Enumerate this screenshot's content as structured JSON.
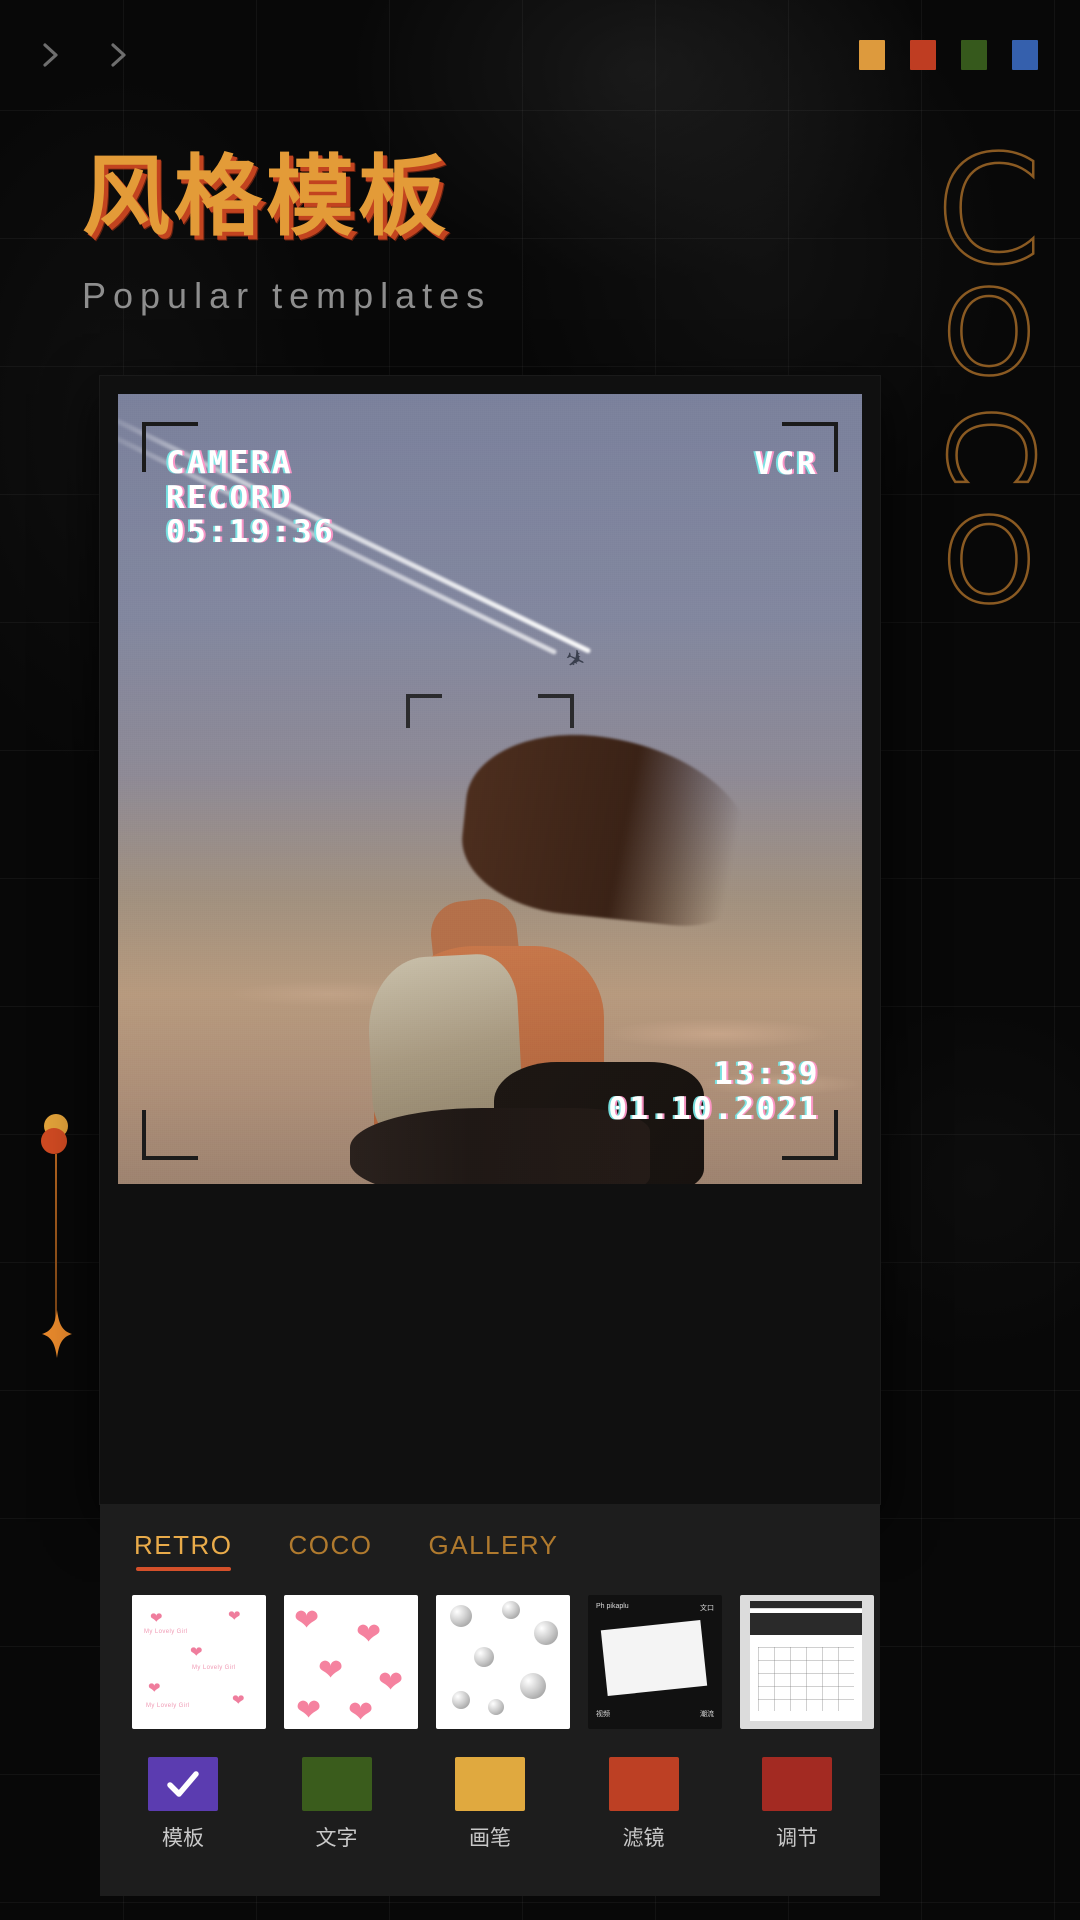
{
  "header": {
    "chevrons": [
      "chevron-right-icon",
      "chevron-right-icon"
    ],
    "swatches": [
      {
        "name": "swatch-amber",
        "color": "#dd9a3d"
      },
      {
        "name": "swatch-red",
        "color": "#bf3d22"
      },
      {
        "name": "swatch-green",
        "color": "#36591c"
      },
      {
        "name": "swatch-blue",
        "color": "#3560ad"
      }
    ]
  },
  "hero": {
    "title": "风格模板",
    "subtitle": "Popular templates",
    "title_color": "#e39b38",
    "title_shadow_color": "#c2431f",
    "side_word": [
      "C",
      "O",
      "C",
      "O"
    ],
    "side_word_color": "#8a5a22"
  },
  "preview": {
    "hud": {
      "label_camera": "CAMERA",
      "label_record": "RECORD",
      "timecode": "05:19:36",
      "label_mode": "VCR",
      "stamp_time": "13:39",
      "stamp_date": "01.10.2021"
    }
  },
  "panel": {
    "tabs": [
      {
        "label": "RETRO",
        "active": true
      },
      {
        "label": "COCO",
        "active": false
      },
      {
        "label": "GALLERY",
        "active": false
      }
    ],
    "thumbnails": [
      {
        "name": "template-thumb-hearts-small",
        "caption": "My Lovely Girl"
      },
      {
        "name": "template-thumb-hearts-large",
        "caption": ""
      },
      {
        "name": "template-thumb-balloons",
        "caption": ""
      },
      {
        "name": "template-thumb-magazine",
        "caption": "Ph pikaplu"
      },
      {
        "name": "template-thumb-phone-ui",
        "caption": ""
      }
    ],
    "tools": [
      {
        "label": "模板",
        "color": "#5b3cb0",
        "icon": "check-icon",
        "selected": true
      },
      {
        "label": "文字",
        "color": "#3a5c1c",
        "icon": "",
        "selected": false
      },
      {
        "label": "画笔",
        "color": "#e0a93f",
        "icon": "",
        "selected": false
      },
      {
        "label": "滤镜",
        "color": "#bd4024",
        "icon": "",
        "selected": false
      },
      {
        "label": "调节",
        "color": "#a32a22",
        "icon": "",
        "selected": false
      }
    ]
  }
}
